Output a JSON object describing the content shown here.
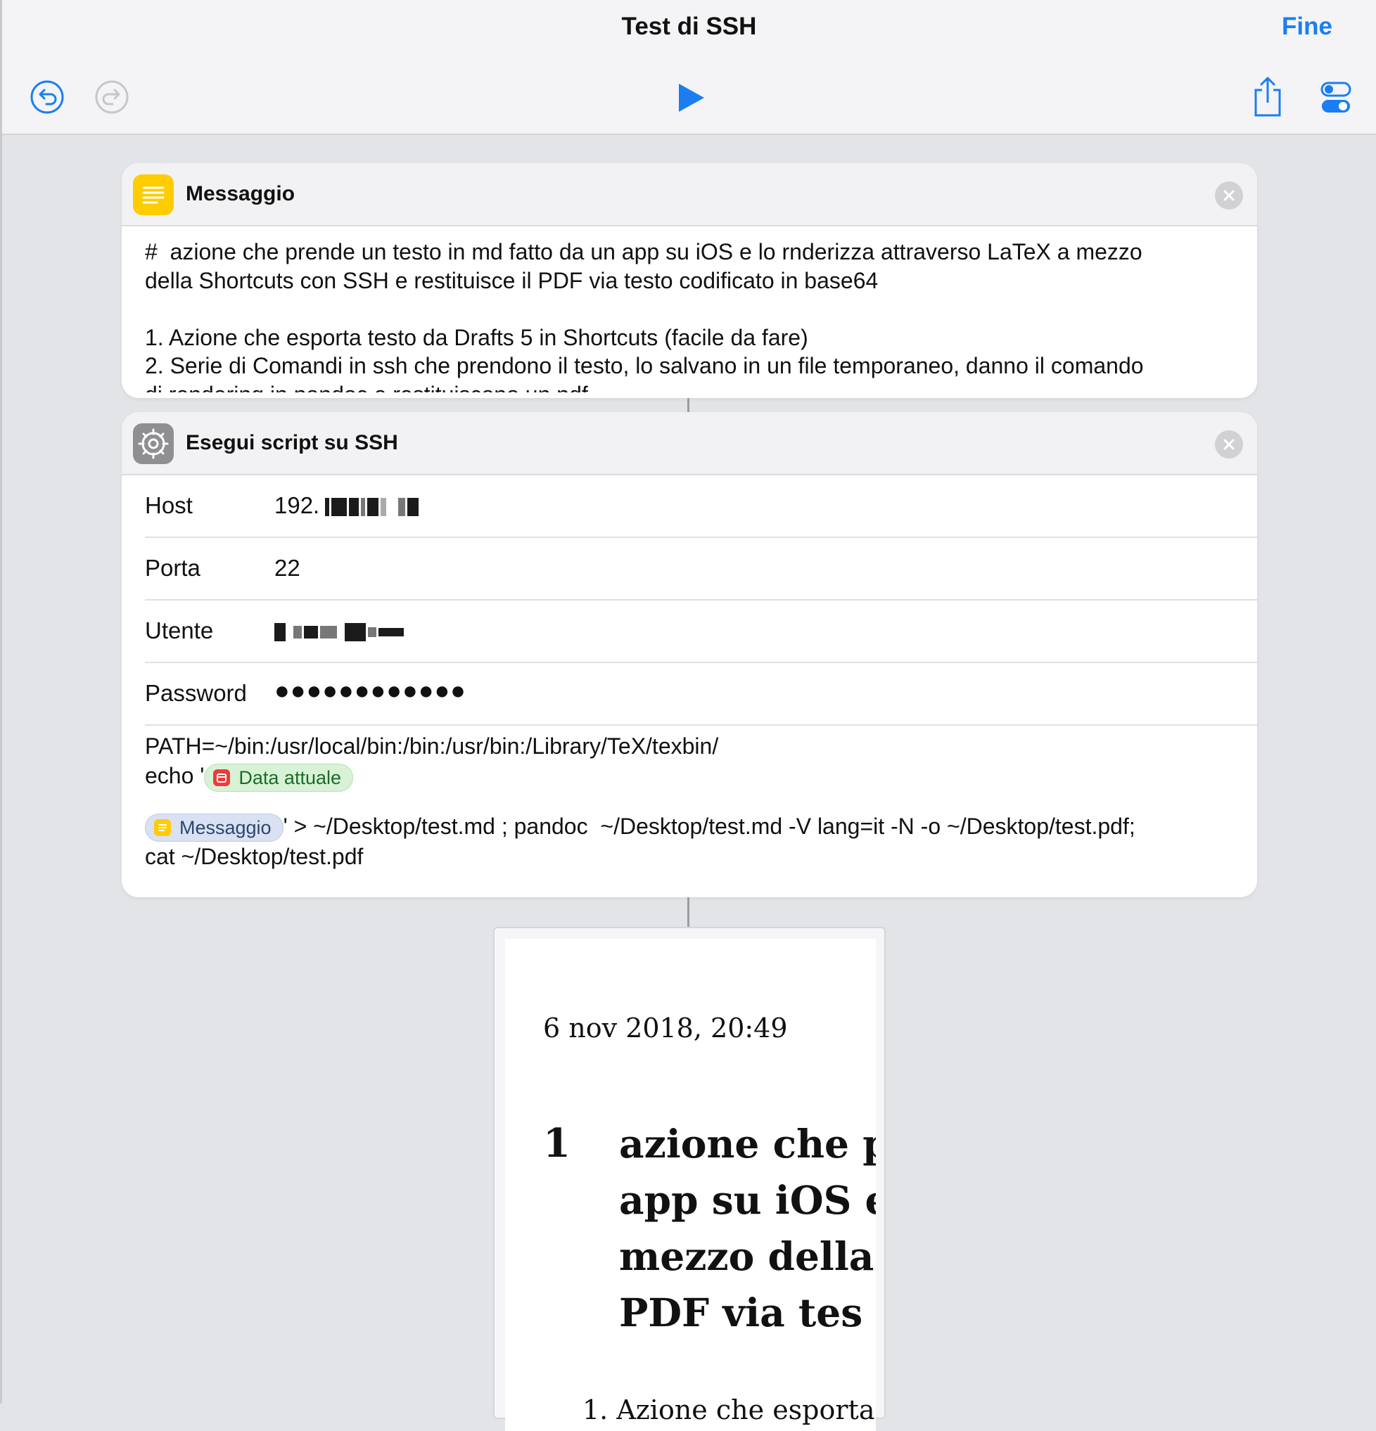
{
  "header": {
    "title": "Test di SSH",
    "done_label": "Fine",
    "icons": [
      "undo-icon",
      "redo-icon",
      "play-icon",
      "share-icon",
      "settings-toggle-icon"
    ],
    "accent_color": "#1a7ef2"
  },
  "message_card": {
    "title": "Messaggio",
    "icon": "text-lines-icon",
    "icon_color": "#ffcc00",
    "lines": [
      "#  azione che prende un testo in md fatto da un app su iOS e lo rnderizza attraverso LaTeX a mezzo",
      "della Shortcuts con SSH e restituisce il PDF via testo codificato in base64",
      "1. Azione che esporta testo da Drafts 5 in Shortcuts (facile da fare)",
      "2. Serie di Comandi in ssh che prendono il testo, lo salvano in un file temporaneo, danno il comando",
      "di rendering in pandoc e restituiscono un pdf"
    ]
  },
  "ssh_card": {
    "title": "Esegui script su SSH",
    "icon": "gear-icon",
    "fields": {
      "host_label": "Host",
      "host_value": "192.",
      "port_label": "Porta",
      "port_value": "22",
      "user_label": "Utente",
      "password_label": "Password",
      "password_value": "●●●●●●●●●●●●"
    },
    "script": {
      "line1": "PATH=~/bin:/usr/local/bin:/bin:/usr/bin:/Library/TeX/texbin/",
      "line2_prefix": "echo '",
      "date_token": "Data attuale",
      "message_token": "Messaggio",
      "line3_suffix": "' > ~/Desktop/test.md ; pandoc  ~/Desktop/test.md -V lang=it -N -o ~/Desktop/test.pdf;",
      "line4": "cat ~/Desktop/test.pdf"
    }
  },
  "pdf_preview": {
    "date": "6 nov 2018, 20:49",
    "section_number": "1",
    "heading_lines": [
      "azione che p",
      "app su iOS e",
      "mezzo della",
      "PDF via tes"
    ],
    "first_item": "1.  Azione che esporta"
  }
}
